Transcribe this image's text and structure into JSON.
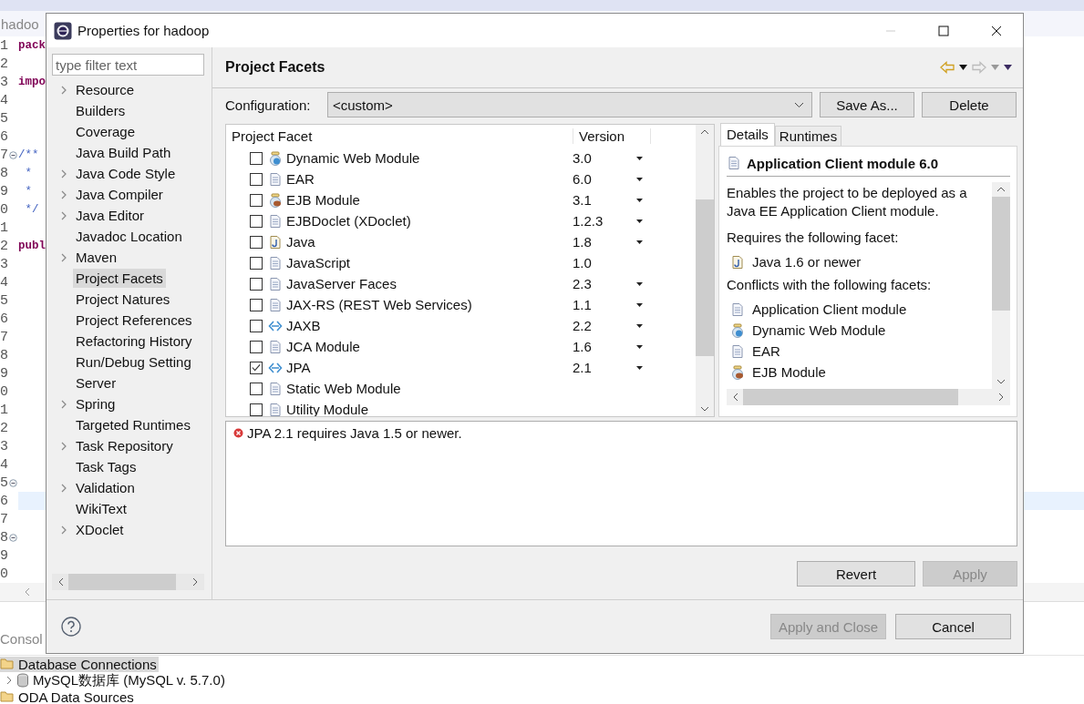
{
  "editor": {
    "tab": "hadoo",
    "lines": [
      {
        "number": "1",
        "code": "pack",
        "kind": "keyword",
        "fold": false,
        "current": false
      },
      {
        "number": "2",
        "fold": false,
        "current": false
      },
      {
        "number": "3",
        "code": "impo",
        "kind": "keyword",
        "fold": false,
        "current": false
      },
      {
        "number": "4",
        "fold": false,
        "current": false
      },
      {
        "number": "5",
        "fold": false,
        "current": false
      },
      {
        "number": "6",
        "fold": false,
        "current": false
      },
      {
        "number": "7",
        "code": "/**",
        "kind": "comment",
        "fold": true,
        "current": false
      },
      {
        "number": "8",
        "code": " *",
        "kind": "comment",
        "fold": false,
        "current": false
      },
      {
        "number": "9",
        "code": " *",
        "kind": "comment",
        "fold": false,
        "current": false
      },
      {
        "number": "0",
        "code": " */",
        "kind": "comment",
        "fold": false,
        "current": false
      },
      {
        "number": "1",
        "fold": false,
        "current": false
      },
      {
        "number": "2",
        "code": "publ",
        "kind": "keyword",
        "fold": false,
        "current": false
      },
      {
        "number": "3",
        "fold": false,
        "current": false
      },
      {
        "number": "4",
        "fold": false,
        "current": false
      },
      {
        "number": "5",
        "fold": false,
        "current": false
      },
      {
        "number": "6",
        "fold": false,
        "current": false
      },
      {
        "number": "7",
        "fold": false,
        "current": false
      },
      {
        "number": "8",
        "fold": false,
        "current": false
      },
      {
        "number": "9",
        "fold": false,
        "current": false
      },
      {
        "number": "0",
        "fold": false,
        "current": false
      },
      {
        "number": "1",
        "fold": false,
        "current": false
      },
      {
        "number": "2",
        "fold": false,
        "current": false
      },
      {
        "number": "3",
        "fold": false,
        "current": false
      },
      {
        "number": "4",
        "fold": false,
        "current": false
      },
      {
        "number": "5",
        "fold": true,
        "current": false
      },
      {
        "number": "6",
        "fold": false,
        "current": true
      },
      {
        "number": "7",
        "fold": false,
        "current": false
      },
      {
        "number": "8",
        "fold": true,
        "current": false
      },
      {
        "number": "9",
        "fold": false,
        "current": false
      },
      {
        "number": "0",
        "fold": false,
        "current": false
      }
    ]
  },
  "bottom_panel": {
    "tab": "Consol",
    "tree": [
      {
        "label": "Database Connections",
        "selected": true,
        "children": [
          {
            "label": "MySQL数据库 (MySQL v. 5.7.0)",
            "expanded": false
          }
        ]
      },
      {
        "label": "ODA Data Sources",
        "selected": false
      }
    ]
  },
  "dialog": {
    "title": "Properties for hadoop",
    "filter": {
      "placeholder": "type filter text"
    },
    "nav": [
      {
        "label": "Resource",
        "expandable": true,
        "selected": false
      },
      {
        "label": "Builders",
        "expandable": false,
        "selected": false
      },
      {
        "label": "Coverage",
        "expandable": false,
        "selected": false
      },
      {
        "label": "Java Build Path",
        "expandable": false,
        "selected": false
      },
      {
        "label": "Java Code Style",
        "expandable": true,
        "selected": false
      },
      {
        "label": "Java Compiler",
        "expandable": true,
        "selected": false
      },
      {
        "label": "Java Editor",
        "expandable": true,
        "selected": false
      },
      {
        "label": "Javadoc Location",
        "expandable": false,
        "selected": false
      },
      {
        "label": "Maven",
        "expandable": true,
        "selected": false
      },
      {
        "label": "Project Facets",
        "expandable": false,
        "selected": true
      },
      {
        "label": "Project Natures",
        "expandable": false,
        "selected": false
      },
      {
        "label": "Project References",
        "expandable": false,
        "selected": false
      },
      {
        "label": "Refactoring History",
        "expandable": false,
        "selected": false
      },
      {
        "label": "Run/Debug Setting",
        "expandable": false,
        "selected": false
      },
      {
        "label": "Server",
        "expandable": false,
        "selected": false
      },
      {
        "label": "Spring",
        "expandable": true,
        "selected": false
      },
      {
        "label": "Targeted Runtimes",
        "expandable": false,
        "selected": false
      },
      {
        "label": "Task Repository",
        "expandable": true,
        "selected": false
      },
      {
        "label": "Task Tags",
        "expandable": false,
        "selected": false
      },
      {
        "label": "Validation",
        "expandable": true,
        "selected": false
      },
      {
        "label": "WikiText",
        "expandable": false,
        "selected": false
      },
      {
        "label": "XDoclet",
        "expandable": true,
        "selected": false
      }
    ],
    "page_title": "Project Facets",
    "history": {
      "back_disabled": false,
      "forward_disabled": true
    },
    "configuration": {
      "label": "Configuration:",
      "value": "<custom>"
    },
    "config_buttons": [
      {
        "label": "Save As...",
        "disabled": false
      },
      {
        "label": "Delete",
        "disabled": false
      }
    ],
    "facets": {
      "columns": [
        "Project Facet",
        "Version"
      ],
      "rows": [
        {
          "name": "Dynamic Web Module",
          "kind": "web",
          "version": "3.0",
          "dropdown": true,
          "checked": false
        },
        {
          "name": "EAR",
          "kind": "doc",
          "version": "6.0",
          "dropdown": true,
          "checked": false
        },
        {
          "name": "EJB Module",
          "kind": "ejb",
          "version": "3.1",
          "dropdown": true,
          "checked": false
        },
        {
          "name": "EJBDoclet (XDoclet)",
          "kind": "doc",
          "version": "1.2.3",
          "dropdown": true,
          "checked": false
        },
        {
          "name": "Java",
          "kind": "java",
          "version": "1.8",
          "dropdown": true,
          "checked": false
        },
        {
          "name": "JavaScript",
          "kind": "doc",
          "version": "1.0",
          "dropdown": false,
          "checked": false
        },
        {
          "name": "JavaServer Faces",
          "kind": "doc",
          "version": "2.3",
          "dropdown": true,
          "checked": false
        },
        {
          "name": "JAX-RS (REST Web Services)",
          "kind": "doc",
          "version": "1.1",
          "dropdown": true,
          "checked": false
        },
        {
          "name": "JAXB",
          "kind": "binding",
          "version": "2.2",
          "dropdown": true,
          "checked": false
        },
        {
          "name": "JCA Module",
          "kind": "doc",
          "version": "1.6",
          "dropdown": true,
          "checked": false
        },
        {
          "name": "JPA",
          "kind": "binding",
          "version": "2.1",
          "dropdown": true,
          "checked": true
        },
        {
          "name": "Static Web Module",
          "kind": "doc",
          "dropdown": false,
          "checked": false
        },
        {
          "name": "Utility Module",
          "kind": "doc",
          "dropdown": false,
          "checked": false
        }
      ]
    },
    "details": {
      "tabs": [
        {
          "label": "Details",
          "selected": true
        },
        {
          "label": "Runtimes",
          "selected": false
        }
      ],
      "heading": {
        "text": "Application Client module 6.0",
        "kind": "doc"
      },
      "description": "Enables the project to be deployed as a Java EE Application Client module.",
      "requires_label": "Requires the following facet:",
      "requires": [
        {
          "label": "Java 1.6 or newer",
          "kind": "java"
        }
      ],
      "conflicts_label": "Conflicts with the following facets:",
      "conflicts": [
        {
          "label": "Application Client module",
          "kind": "doc"
        },
        {
          "label": "Dynamic Web Module",
          "kind": "web"
        },
        {
          "label": "EAR",
          "kind": "doc"
        },
        {
          "label": "EJB Module",
          "kind": "ejb"
        }
      ]
    },
    "problems": [
      {
        "kind": "error",
        "text": "JPA 2.1 requires Java 1.5 or newer."
      }
    ],
    "page_buttons": [
      {
        "label": "Revert",
        "disabled": false
      },
      {
        "label": "Apply",
        "disabled": true
      }
    ],
    "footer_buttons": [
      {
        "label": "Apply and Close",
        "disabled": true
      },
      {
        "label": "Cancel",
        "disabled": false
      }
    ]
  }
}
